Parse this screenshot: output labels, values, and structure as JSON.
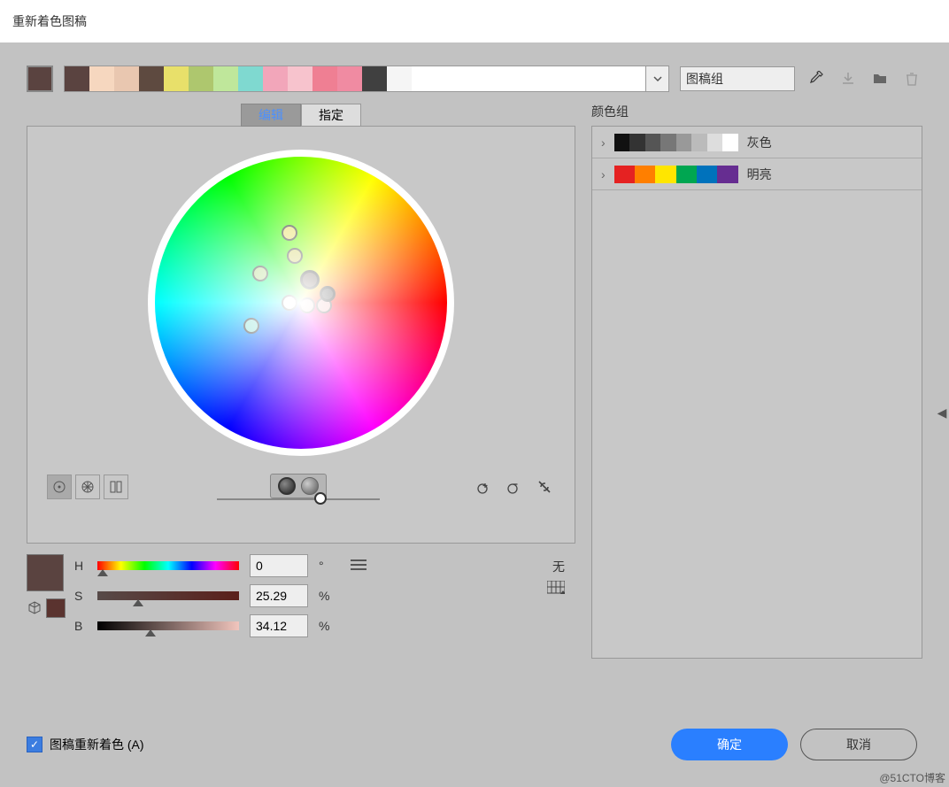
{
  "title": "重新着色图稿",
  "swatches": [
    "#5a4340",
    "#f6d7bf",
    "#e9c7b0",
    "#5e4a40",
    "#e8e06a",
    "#aec76e",
    "#bfe79b",
    "#7fd9d0",
    "#f2a6ba",
    "#f7c3cd",
    "#ef7f93",
    "#f08ba2",
    "#404040",
    "#f5f5f5"
  ],
  "group_input": "图稿组",
  "tabs": {
    "edit": "编辑",
    "assign": "指定"
  },
  "right_label": "颜色组",
  "groups": [
    {
      "name": "灰色",
      "colors": [
        "#111",
        "#333",
        "#555",
        "#777",
        "#999",
        "#bbb",
        "#ddd",
        "#fff"
      ]
    },
    {
      "name": "明亮",
      "colors": [
        "#e52222",
        "#ff7f00",
        "#ffe600",
        "#00a651",
        "#0072bc",
        "#662d91"
      ]
    }
  ],
  "hsb": {
    "h": {
      "label": "H",
      "value": "0",
      "unit": "°"
    },
    "s": {
      "label": "S",
      "value": "25.29",
      "unit": "%"
    },
    "b": {
      "label": "B",
      "value": "34.12",
      "unit": "%"
    }
  },
  "none": "无",
  "recolor_checkbox": "图稿重新着色 (A)",
  "ok": "确定",
  "cancel": "取消",
  "watermark": "@51CTO博客"
}
